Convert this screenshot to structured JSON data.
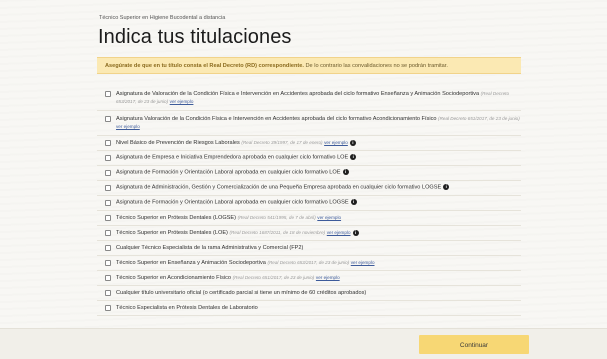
{
  "breadcrumb": "Técnico Superior en Higiene Bucodental a distancia",
  "page_title": "Indica tus titulaciones",
  "notice": {
    "bold": "Asegúrate de que en tu título consta el Real Decreto (RD) correspondiente.",
    "rest": " De lo contrario las convalidaciones no se podrán tramitar."
  },
  "options": [
    {
      "label": "Asignatura de Valoración de la Condición Física e Intervención en Accidentes aprobada del ciclo formativo Enseñanza y Animación Sociodeportiva",
      "hint": "(Real Decreto 653/2017, de 23 de junio)",
      "link": "ver ejemplo",
      "info": false,
      "type": "double"
    },
    {
      "label": "Asignatura Valoración de la Condición Física e Intervención en Accidentes aprobada del ciclo formativo Acondicionamiento Físico",
      "hint": "(Real Decreto 651/2017, de 23 de junio)",
      "link": "ver ejemplo",
      "info": false,
      "type": "double"
    },
    {
      "label": "Nivel Básico de Prevención de Riesgos Laborales",
      "hint": "(Real Decreto 39/1997, de 17 de enero)",
      "link": "ver ejemplo",
      "info": true,
      "type": "single"
    },
    {
      "label": "Asignatura de Empresa e Iniciativa Emprendedora aprobada en cualquier ciclo formativo LOE",
      "hint": "",
      "link": "",
      "info": true,
      "type": "single"
    },
    {
      "label": "Asignatura de Formación y Orientación Laboral aprobada en cualquier ciclo formativo LOE",
      "hint": "",
      "link": "",
      "info": true,
      "type": "single"
    },
    {
      "label": "Asignatura de Administración, Gestión y Comercialización de una Pequeña Empresa aprobada en cualquier ciclo formativo LOGSE",
      "hint": "",
      "link": "",
      "info": true,
      "type": "single"
    },
    {
      "label": "Asignatura de Formación y Orientación Laboral aprobada en cualquier ciclo formativo LOGSE",
      "hint": "",
      "link": "",
      "info": true,
      "type": "single"
    },
    {
      "label": "Técnico Superior en Prótesis Dentales (LOGSE)",
      "hint": "(Real Decreto 541/1995, de 7 de abril)",
      "link": "ver ejemplo",
      "info": false,
      "type": "single"
    },
    {
      "label": "Técnico Superior en Prótesis Dentales (LOE)",
      "hint": "(Real Decreto 1687/2011, de 18 de noviembre)",
      "link": "ver ejemplo",
      "info": true,
      "type": "single"
    },
    {
      "label": "Cualquier Técnico Especialista de la rama Administrativa y Comercial (FP2)",
      "hint": "",
      "link": "",
      "info": false,
      "type": "single"
    },
    {
      "label": "Técnico Superior en Enseñanza y Animación Sociodeportiva",
      "hint": "(Real Decreto 653/2017, de 23 de junio)",
      "link": "ver ejemplo",
      "info": false,
      "type": "single"
    },
    {
      "label": "Técnico Superior en Acondicionamiento Físico",
      "hint": "(Real Decreto 651/2017, de 23 de junio)",
      "link": "ver ejemplo",
      "info": false,
      "type": "single"
    },
    {
      "label": "Cualquier título universitario oficial (o certificado parcial si tiene un mínimo de 60 créditos aprobados)",
      "hint": "",
      "link": "",
      "info": false,
      "type": "single"
    },
    {
      "label": "Técnico Especialista en Prótesis Dentales de Laboratorio",
      "hint": "",
      "link": "",
      "info": false,
      "type": "single"
    }
  ],
  "continue_label": "Continuar",
  "info_glyph": "i"
}
